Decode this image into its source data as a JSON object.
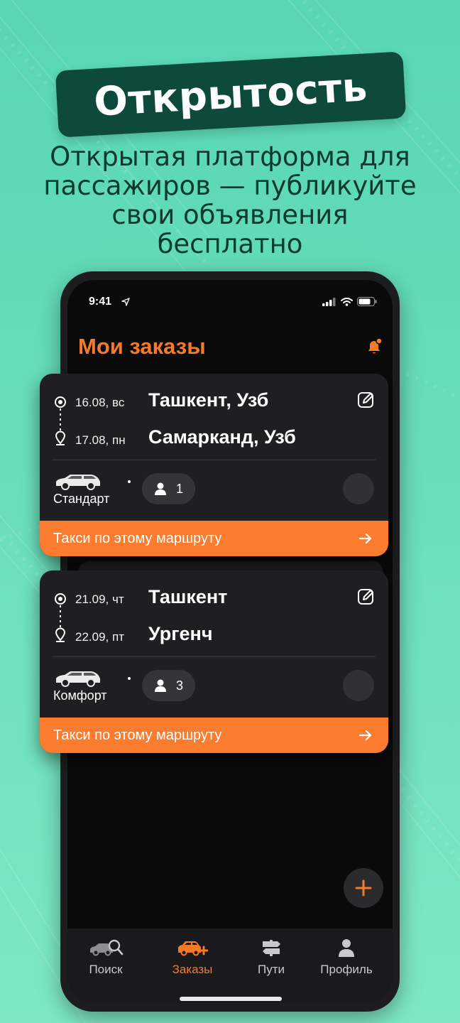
{
  "promo": {
    "headline": "Открытость",
    "subtitle_lines": [
      "Открытая платформа для",
      "пассажиров — публикуйте",
      "свои объявления",
      "бесплатно"
    ]
  },
  "status_bar": {
    "time": "9:41"
  },
  "screen": {
    "title": "Мои заказы"
  },
  "orders": [
    {
      "from_date": "16.08, вс",
      "from_city": "Ташкент, Узб",
      "to_date": "17.08, пн",
      "to_city": "Самарканд, Узб",
      "car_class": "Стандарт",
      "seats": "1",
      "cta": "Такси по этому маршруту"
    },
    {
      "from_date": "21.09, чт",
      "from_city": "Ташкент",
      "to_date": "22.09, пт",
      "to_city": "Ургенч",
      "car_class": "Комфорт",
      "seats": "3",
      "cta": "Такси по этому маршруту"
    }
  ],
  "tabs": [
    {
      "label": "Поиск",
      "icon": "car-search-icon",
      "active": false
    },
    {
      "label": "Заказы",
      "icon": "car-add-icon",
      "active": true
    },
    {
      "label": "Пути",
      "icon": "signpost-icon",
      "active": false
    },
    {
      "label": "Профиль",
      "icon": "person-icon",
      "active": false
    }
  ],
  "colors": {
    "accent": "#f47b2c",
    "headline_bg": "#0d4a3b",
    "background": "#63d9b8"
  }
}
